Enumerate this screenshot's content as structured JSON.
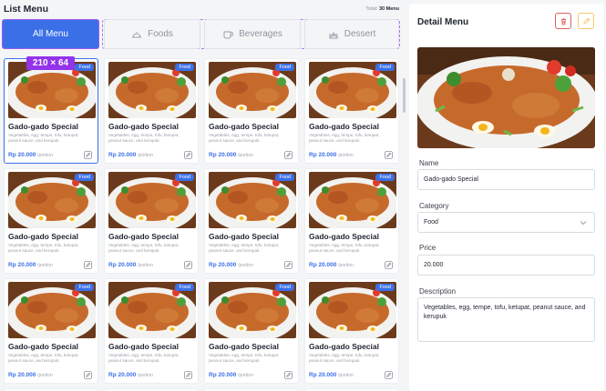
{
  "list": {
    "title": "List Menu",
    "total_label": "Total:",
    "total_value": "30 Menu"
  },
  "tabs": [
    {
      "label": "All Menu",
      "icon": "none",
      "active": true
    },
    {
      "label": "Foods",
      "icon": "cloche-icon",
      "active": false
    },
    {
      "label": "Beverages",
      "icon": "cup-icon",
      "active": false
    },
    {
      "label": "Dessert",
      "icon": "cake-icon",
      "active": false
    }
  ],
  "selection_badge": "210 × 64",
  "card": {
    "tag": "Food",
    "name": "Gado-gado Special",
    "desc": "Vegetables, egg, tempe, tofu, ketupat, peanut sauce, and kerupuk.",
    "price": "Rp 20.000",
    "unit": "/portion"
  },
  "detail": {
    "title": "Detail Menu",
    "name_label": "Name",
    "name_value": "Gado-gado Special",
    "category_label": "Category",
    "category_value": "Food",
    "price_label": "Price",
    "price_value": "20.000",
    "description_label": "Description",
    "description_value": "Vegetables, egg, tempe, tofu, ketupat, peanut sauce, and kerupuk"
  },
  "colors": {
    "accent": "#3b6fe8",
    "selection": "#9333ea",
    "delete": "#e06060",
    "edit": "#f3c86a"
  }
}
